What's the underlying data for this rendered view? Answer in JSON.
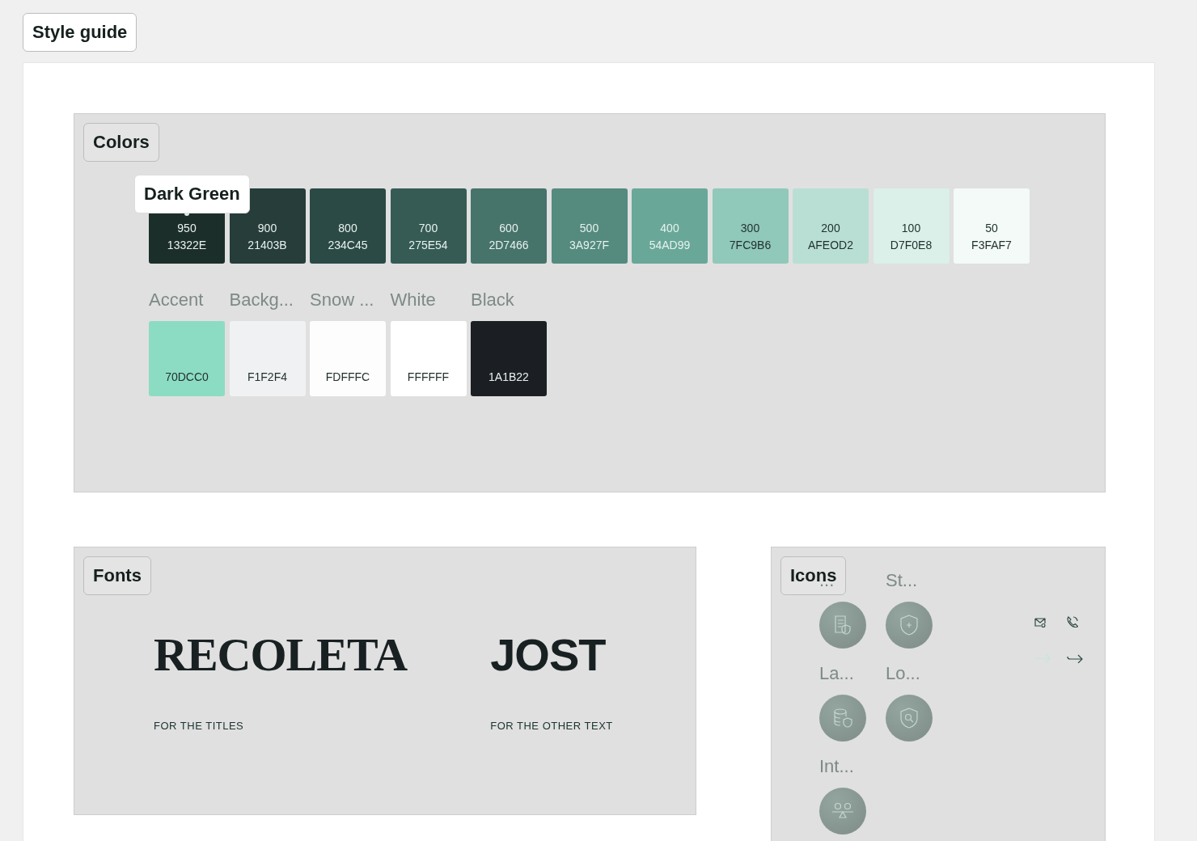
{
  "page_label": "Style guide",
  "colors": {
    "title": "Colors",
    "palette": [
      {
        "shade": "950",
        "hex": "13322E",
        "color": "#1c2e2a",
        "tooltip": "Dark Green"
      },
      {
        "shade": "900",
        "hex": "21403B",
        "color": "#263d3a"
      },
      {
        "shade": "800",
        "hex": "234C45",
        "color": "#2c4a45"
      },
      {
        "shade": "700",
        "hex": "275E54",
        "color": "#365b55"
      },
      {
        "shade": "600",
        "hex": "2D7466",
        "color": "#46736a"
      },
      {
        "shade": "500",
        "hex": "3A927F",
        "color": "#548b7e"
      },
      {
        "shade": "400",
        "hex": "54AD99",
        "color": "#69a898"
      },
      {
        "shade": "300",
        "hex": "7FC9B6",
        "color": "#90c8b9"
      },
      {
        "shade": "200",
        "hex": "AFEOD2",
        "color": "#b9dfd5"
      },
      {
        "shade": "100",
        "hex": "D7F0E8",
        "color": "#daf0e9"
      },
      {
        "shade": "50",
        "hex": "F3FAF7",
        "color": "#f3faf7"
      }
    ],
    "named": [
      {
        "name": "Accent",
        "hex": "70DCC0",
        "color": "#8cdcc3"
      },
      {
        "name": "Backg...",
        "hex": "F1F2F4",
        "color": "#f0f1f3"
      },
      {
        "name": "Snow ...",
        "hex": "FDFFFC",
        "color": "#fcfdfc"
      },
      {
        "name": "White",
        "hex": "FFFFFF",
        "color": "#ffffff"
      },
      {
        "name": "Black",
        "hex": "1A1B22",
        "color": "#1b1f23"
      }
    ]
  },
  "fonts": {
    "title": "Fonts",
    "items": [
      {
        "kind": "serif",
        "name": "RECOLETA",
        "caption": "FOR  THE  TITLES"
      },
      {
        "kind": "sans",
        "name": "JOST",
        "caption": "FOR THE OTHER TEXT"
      }
    ]
  },
  "icons": {
    "title": "Icons",
    "items": [
      {
        "kind": "document-shield",
        "label": "..."
      },
      {
        "kind": "shield-plus",
        "label": "St..."
      },
      {
        "kind": "database-shield",
        "label": "La..."
      },
      {
        "kind": "shield-search",
        "label": "Lo..."
      },
      {
        "kind": "people-balance",
        "label": "Int..."
      }
    ],
    "small": [
      {
        "kind": "mail"
      },
      {
        "kind": "phone"
      },
      {
        "kind": "arrow-light"
      },
      {
        "kind": "arrow"
      }
    ]
  }
}
